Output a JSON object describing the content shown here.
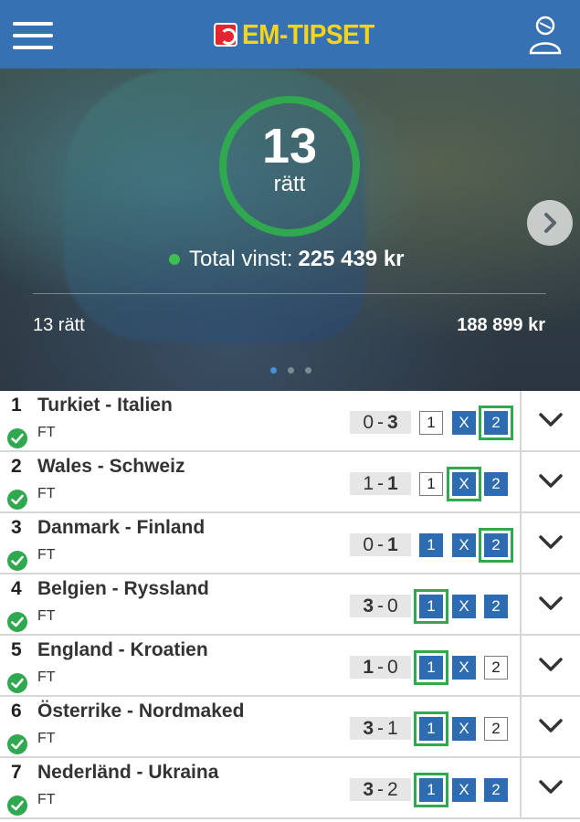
{
  "header": {
    "logo_text": "EM-TIPSET",
    "brand_yellow": "#f7d417",
    "brand_blue": "#3672b3",
    "menu_icon": "hamburger-menu-icon",
    "user_icon": "user-account-icon"
  },
  "hero": {
    "correct_count": "13",
    "correct_label": "rätt",
    "total_label": "Total vinst:",
    "total_amount": "225 439 kr",
    "tier_label": "13 rätt",
    "tier_amount": "188 899 kr",
    "carousel_pages": 3,
    "carousel_active": 1
  },
  "matches": [
    {
      "index": "1",
      "teams": "Turkiet - Italien",
      "status": "FT",
      "home": "0",
      "away": "3",
      "bold": "away",
      "picks": [
        "1",
        "X",
        "2"
      ],
      "selected": [
        false,
        true,
        true
      ],
      "correct": "2"
    },
    {
      "index": "2",
      "teams": "Wales - Schweiz",
      "status": "FT",
      "home": "1",
      "away": "1",
      "bold": "away",
      "picks": [
        "1",
        "X",
        "2"
      ],
      "selected": [
        false,
        true,
        true
      ],
      "correct": "X"
    },
    {
      "index": "3",
      "teams": "Danmark - Finland",
      "status": "FT",
      "home": "0",
      "away": "1",
      "bold": "away",
      "picks": [
        "1",
        "X",
        "2"
      ],
      "selected": [
        true,
        true,
        true
      ],
      "correct": "2"
    },
    {
      "index": "4",
      "teams": "Belgien - Ryssland",
      "status": "FT",
      "home": "3",
      "away": "0",
      "bold": "home",
      "picks": [
        "1",
        "X",
        "2"
      ],
      "selected": [
        true,
        true,
        true
      ],
      "correct": "1"
    },
    {
      "index": "5",
      "teams": "England - Kroatien",
      "status": "FT",
      "home": "1",
      "away": "0",
      "bold": "home",
      "picks": [
        "1",
        "X",
        "2"
      ],
      "selected": [
        true,
        true,
        false
      ],
      "correct": "1"
    },
    {
      "index": "6",
      "teams": "Österrike - Nordmaked",
      "status": "FT",
      "home": "3",
      "away": "1",
      "bold": "home",
      "picks": [
        "1",
        "X",
        "2"
      ],
      "selected": [
        true,
        true,
        false
      ],
      "correct": "1"
    },
    {
      "index": "7",
      "teams": "Nederländ - Ukraina",
      "status": "FT",
      "home": "3",
      "away": "2",
      "bold": "home",
      "picks": [
        "1",
        "X",
        "2"
      ],
      "selected": [
        true,
        true,
        true
      ],
      "correct": "1"
    }
  ],
  "colors": {
    "correct_green": "#2fa84f",
    "pick_blue": "#2d6cb0"
  }
}
